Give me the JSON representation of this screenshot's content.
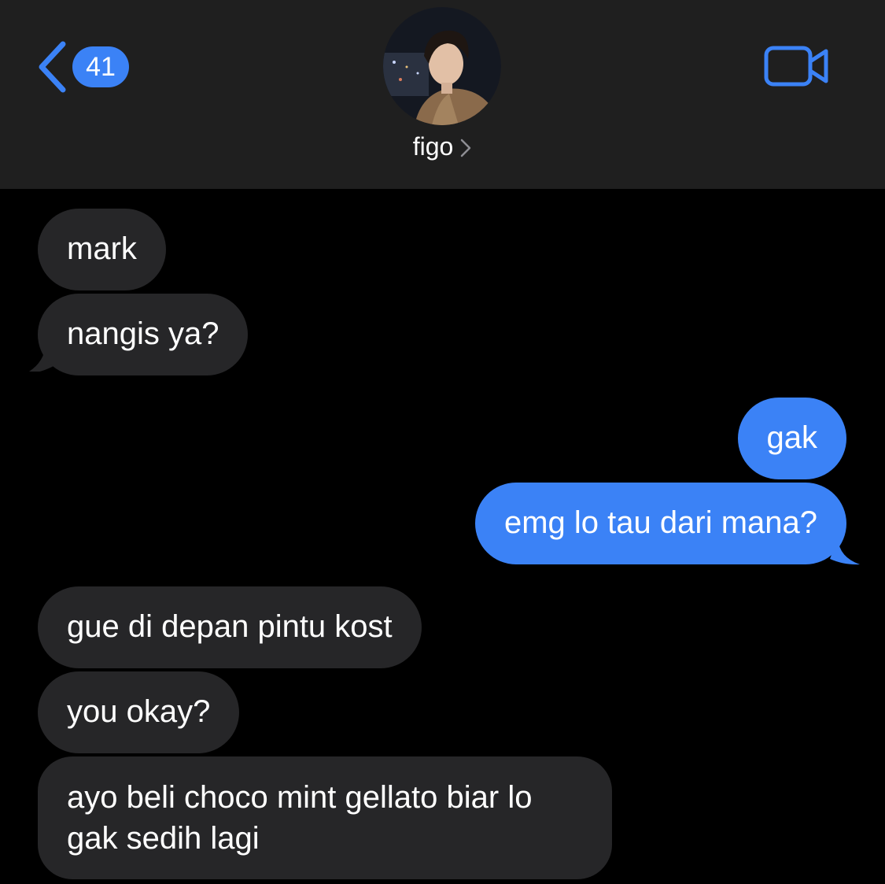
{
  "header": {
    "back_badge": "41",
    "contact_name": "figo",
    "icons": {
      "back": "chevron-left-icon",
      "video": "video-camera-icon",
      "disclosure": "chevron-right-icon"
    }
  },
  "colors": {
    "accent": "#3b82f6",
    "header_bg": "#1f1f1f",
    "incoming_bubble": "#262628",
    "outgoing_bubble": "#3b82f6",
    "background": "#000000"
  },
  "messages": [
    {
      "from": "them",
      "text": "mark"
    },
    {
      "from": "them",
      "text": "nangis ya?"
    },
    {
      "from": "me",
      "text": "gak"
    },
    {
      "from": "me",
      "text": "emg lo tau dari mana?"
    },
    {
      "from": "them",
      "text": "gue di depan pintu kost"
    },
    {
      "from": "them",
      "text": "you okay?"
    },
    {
      "from": "them",
      "text": "ayo beli choco mint gellato biar lo gak sedih lagi"
    }
  ]
}
